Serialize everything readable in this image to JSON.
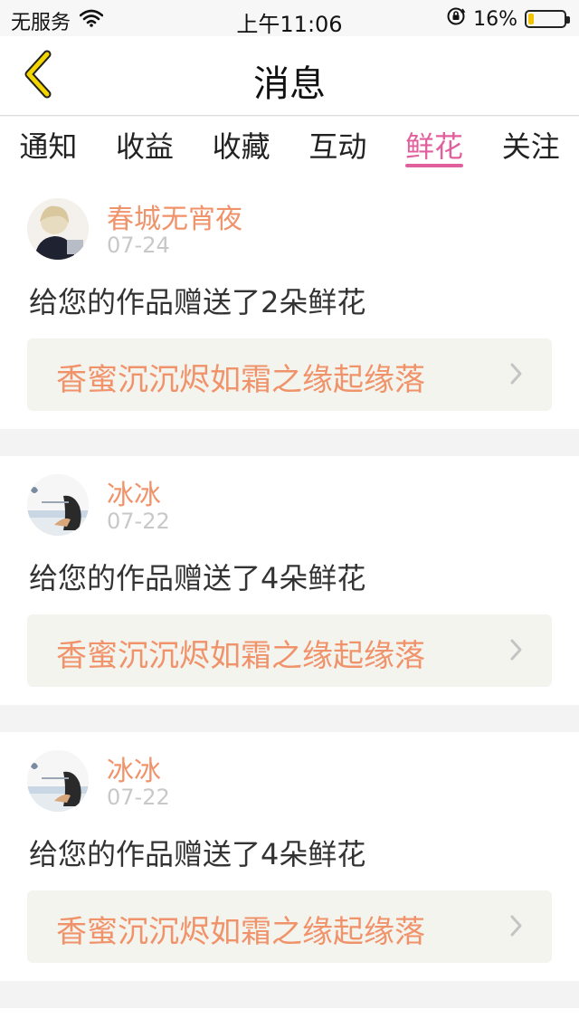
{
  "status_bar": {
    "carrier": "无服务",
    "time": "上午11:06",
    "battery_percent_label": "16%",
    "battery_level": 0.16,
    "icons": [
      "wifi-icon",
      "orientation-lock-icon",
      "battery-icon"
    ]
  },
  "nav": {
    "title": "消息",
    "back_icon": "chevron-left-icon",
    "accent": "#f3d500"
  },
  "tabs": [
    {
      "label": "通知",
      "active": false
    },
    {
      "label": "收益",
      "active": false
    },
    {
      "label": "收藏",
      "active": false
    },
    {
      "label": "互动",
      "active": false
    },
    {
      "label": "鲜花",
      "active": true
    },
    {
      "label": "关注",
      "active": false
    }
  ],
  "colors": {
    "active_tab": "#e0609d",
    "name_and_link": "#f0926a",
    "date": "#c8c8c8"
  },
  "messages": [
    {
      "user": "春城无宵夜",
      "date": "07-24",
      "text": "给您的作品赠送了2朵鲜花",
      "work": "香蜜沉沉烬如霜之缘起缘落"
    },
    {
      "user": "冰冰",
      "date": "07-22",
      "text": "给您的作品赠送了4朵鲜花",
      "work": "香蜜沉沉烬如霜之缘起缘落"
    },
    {
      "user": "冰冰",
      "date": "07-22",
      "text": "给您的作品赠送了4朵鲜花",
      "work": "香蜜沉沉烬如霜之缘起缘落"
    }
  ]
}
